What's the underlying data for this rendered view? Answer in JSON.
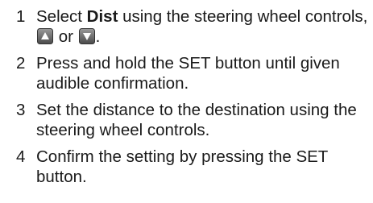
{
  "steps": [
    {
      "number": "1",
      "text_before": "Select ",
      "bold": "Dist",
      "text_mid": " using the steering wheel controls, ",
      "icon_up": "up-arrow-key-icon",
      "or_word": " or ",
      "icon_down": "down-arrow-key-icon",
      "text_end": "."
    },
    {
      "number": "2",
      "text": "Press and hold the SET button until given audible confirmation."
    },
    {
      "number": "3",
      "text": "Set the distance to the destination using the steering wheel controls."
    },
    {
      "number": "4",
      "text": "Confirm the setting by pressing the SET button."
    }
  ]
}
